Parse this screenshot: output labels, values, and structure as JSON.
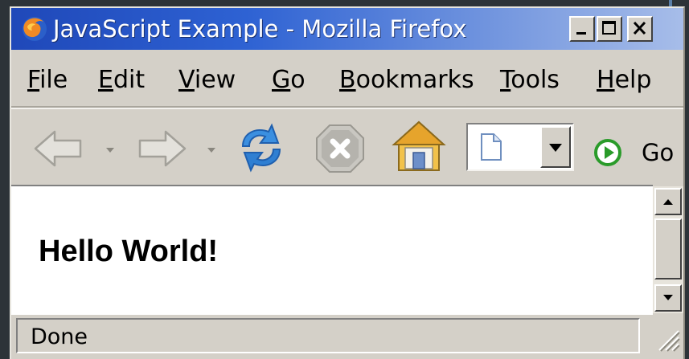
{
  "window": {
    "title": "JavaScript Example - Mozilla Firefox",
    "icon": "firefox-logo-icon"
  },
  "caption_buttons": [
    "minimize-icon",
    "maximize-icon",
    "close-icon"
  ],
  "menu": {
    "items": [
      {
        "pre": "",
        "key": "F",
        "post": "ile"
      },
      {
        "pre": "",
        "key": "E",
        "post": "dit"
      },
      {
        "pre": "",
        "key": "V",
        "post": "iew"
      },
      {
        "pre": "",
        "key": "G",
        "post": "o"
      },
      {
        "pre": "",
        "key": "B",
        "post": "ookmarks"
      },
      {
        "pre": "",
        "key": "T",
        "post": "ools"
      },
      {
        "pre": "",
        "key": "H",
        "post": "elp"
      }
    ]
  },
  "toolbar": {
    "icons": [
      "back-arrow-icon",
      "forward-arrow-icon",
      "reload-icon",
      "stop-icon",
      "home-icon",
      "page-icon",
      "go-arrow-icon"
    ],
    "go_label": "Go"
  },
  "content": {
    "heading": "Hello World!"
  },
  "status": {
    "text": "Done"
  },
  "colors": {
    "titlebar_start": "#1f48b9",
    "titlebar_end": "#a7bde9",
    "chrome": "#d4d0c8",
    "page_background": "#ffffff"
  }
}
